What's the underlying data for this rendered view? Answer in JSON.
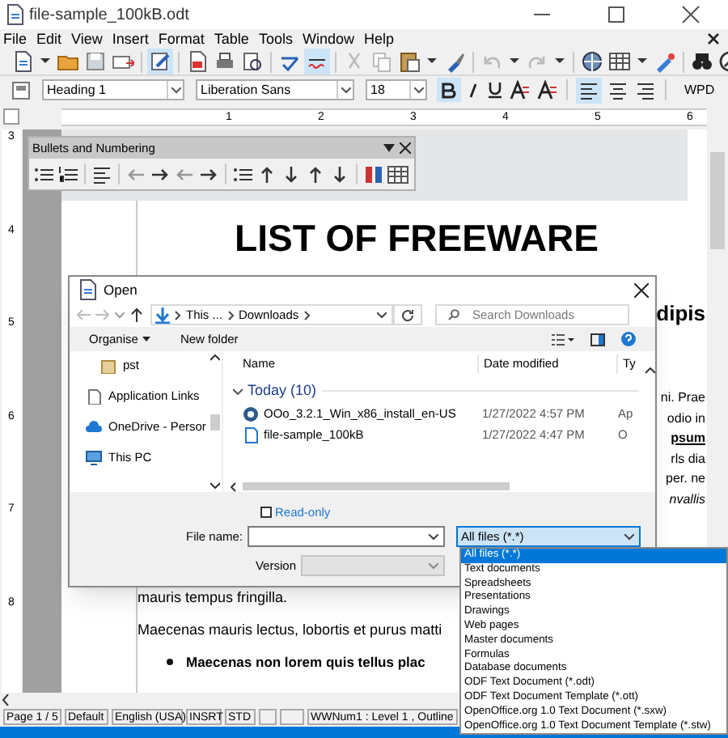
{
  "window": {
    "title": "file-sample_100kB.odt"
  },
  "menu": [
    "File",
    "Edit",
    "View",
    "Insert",
    "Format",
    "Table",
    "Tools",
    "Window",
    "Help"
  ],
  "formatting_toolbar": {
    "paragraph_style": "Heading 1",
    "font_name": "Liberation Sans",
    "font_size": "18",
    "bold_on": true,
    "align_left_on": true,
    "extension_label": "WPD"
  },
  "ruler": {
    "labels": [
      "1",
      "2",
      "3",
      "4",
      "5",
      "6"
    ]
  },
  "vertical_ruler": {
    "labels": [
      "3",
      "4",
      "5",
      "6",
      "7",
      "8"
    ]
  },
  "bullets_toolbar": {
    "title": "Bullets and Numbering"
  },
  "document": {
    "title": "LIST OF FREEWARE",
    "side_fragments": [
      {
        "text": "dipis",
        "kind": "heading"
      },
      {
        "text": "ni. Prae",
        "kind": "plain"
      },
      {
        "text": "odio in",
        "kind": "plain"
      },
      {
        "text": "psum",
        "kind": "bold"
      },
      {
        "text": "rls dia",
        "kind": "plain"
      },
      {
        "text": "per. ne",
        "kind": "plain"
      },
      {
        "text": "nvallis",
        "kind": "italic"
      }
    ],
    "paragraphs": [
      {
        "text": "mauris tempus fringilla.",
        "kind": "plain"
      },
      {
        "text": "Maecenas mauris lectus, lobortis et purus matti",
        "kind": "plain"
      },
      {
        "text": "Maecenas non lorem quis tellus plac",
        "kind": "bullet"
      }
    ]
  },
  "open_dialog": {
    "title": "Open",
    "path": [
      "This ...",
      "Downloads"
    ],
    "search": {
      "placeholder": "Search Downloads"
    },
    "commands": [
      "Organise",
      "New folder"
    ],
    "nav_items": [
      {
        "label": "pst",
        "kind": "folder"
      },
      {
        "label": "Application Links",
        "kind": "file"
      },
      {
        "label": "OneDrive - Persor",
        "kind": "cloud"
      },
      {
        "label": "This PC",
        "kind": "pc"
      }
    ],
    "columns": [
      "Name",
      "Date modified",
      "Ty"
    ],
    "group": "Today (10)",
    "files": [
      {
        "name": "OOo_3.2.1_Win_x86_install_en-US",
        "date": "1/27/2022 4:57 PM",
        "type": "Ap",
        "kind": "installer"
      },
      {
        "name": "file-sample_100kB",
        "date": "1/27/2022 4:47 PM",
        "type": "O",
        "kind": "document"
      }
    ],
    "read_only": {
      "label": "Read-only",
      "checked": false
    },
    "file_name": {
      "label": "File name:"
    },
    "version": {
      "label": "Version",
      "disabled": true
    },
    "file_type": {
      "value": "All files (*.*)",
      "expanded": true,
      "options": [
        {
          "label": "All files (*.*)",
          "selected": true
        },
        {
          "label": "Text documents",
          "selected": false
        },
        {
          "label": "Spreadsheets",
          "selected": false
        },
        {
          "label": "Presentations",
          "selected": false
        },
        {
          "label": "Drawings",
          "selected": false
        },
        {
          "label": "Web pages",
          "selected": false
        },
        {
          "label": "Master documents",
          "selected": false
        },
        {
          "label": "Formulas",
          "selected": false
        },
        {
          "label": "Database documents",
          "selected": false
        },
        {
          "label": "ODF Text Document (*.odt)",
          "selected": false
        },
        {
          "label": "ODF Text Document Template (*.ott)",
          "selected": false
        },
        {
          "label": "OpenOffice.org 1.0 Text Document (*.sxw)",
          "selected": false
        },
        {
          "label": "OpenOffice.org 1.0 Text Document Template (*.stw)",
          "selected": false
        }
      ]
    }
  },
  "status_bar": [
    {
      "kind": "field",
      "text": "Page 1 / 5"
    },
    {
      "kind": "field",
      "text": "Default"
    },
    {
      "kind": "field",
      "text": "English (USA)"
    },
    {
      "kind": "field",
      "text": "INSRT"
    },
    {
      "kind": "field",
      "text": "STD"
    },
    {
      "kind": "blank"
    },
    {
      "kind": "blank"
    },
    {
      "kind": "field",
      "text": "WWNum1 : Level 1 , Outline"
    }
  ]
}
